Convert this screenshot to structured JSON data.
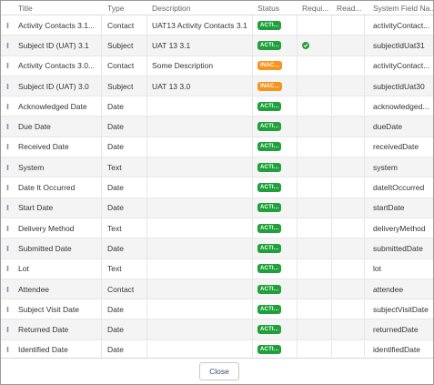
{
  "columns": {
    "title": "Title",
    "type": "Type",
    "description": "Description",
    "status": "Status",
    "required": "Requi...",
    "read_only": "Read...",
    "system_field_name": "System Field Na..."
  },
  "rows": [
    {
      "title": "Activity Contacts 3.1...",
      "type": "Contact",
      "description": "UAT13 Activity Contacts 3.1",
      "status": "ACTI...",
      "status_kind": "active",
      "required": false,
      "system_field_name": "activityContact..."
    },
    {
      "title": "Subject ID (UAT) 3.1",
      "type": "Subject",
      "description": "UAT 13 3.1",
      "status": "ACTI...",
      "status_kind": "active",
      "required": true,
      "system_field_name": "subjectIdUat31"
    },
    {
      "title": "Activity Contacts 3.0...",
      "type": "Contact",
      "description": "Some Description",
      "status": "INAC...",
      "status_kind": "inactive",
      "required": false,
      "system_field_name": "activityContact..."
    },
    {
      "title": "Subject ID (UAT) 3.0",
      "type": "Subject",
      "description": "UAT 13 3.0",
      "status": "INAC...",
      "status_kind": "inactive",
      "required": false,
      "system_field_name": "subjectIdUat30"
    },
    {
      "title": "Acknowledged Date",
      "type": "Date",
      "description": "",
      "status": "ACTI...",
      "status_kind": "active",
      "required": false,
      "system_field_name": "acknowledged..."
    },
    {
      "title": "Due Date",
      "type": "Date",
      "description": "",
      "status": "ACTI...",
      "status_kind": "active",
      "required": false,
      "system_field_name": "dueDate"
    },
    {
      "title": "Received Date",
      "type": "Date",
      "description": "",
      "status": "ACTI...",
      "status_kind": "active",
      "required": false,
      "system_field_name": "receivedDate"
    },
    {
      "title": "System",
      "type": "Text",
      "description": "",
      "status": "ACTI...",
      "status_kind": "active",
      "required": false,
      "system_field_name": "system"
    },
    {
      "title": "Date It Occurred",
      "type": "Date",
      "description": "",
      "status": "ACTI...",
      "status_kind": "active",
      "required": false,
      "system_field_name": "dateItOccurred"
    },
    {
      "title": "Start Date",
      "type": "Date",
      "description": "",
      "status": "ACTI...",
      "status_kind": "active",
      "required": false,
      "system_field_name": "startDate"
    },
    {
      "title": "Delivery Method",
      "type": "Text",
      "description": "",
      "status": "ACTI...",
      "status_kind": "active",
      "required": false,
      "system_field_name": "deliveryMethod"
    },
    {
      "title": "Submitted Date",
      "type": "Date",
      "description": "",
      "status": "ACTI...",
      "status_kind": "active",
      "required": false,
      "system_field_name": "submittedDate"
    },
    {
      "title": "Lot",
      "type": "Text",
      "description": "",
      "status": "ACTI...",
      "status_kind": "active",
      "required": false,
      "system_field_name": "lot"
    },
    {
      "title": "Attendee",
      "type": "Contact",
      "description": "",
      "status": "ACTI...",
      "status_kind": "active",
      "required": false,
      "system_field_name": "attendee"
    },
    {
      "title": "Subject Visit Date",
      "type": "Date",
      "description": "",
      "status": "ACTI...",
      "status_kind": "active",
      "required": false,
      "system_field_name": "subjectVisitDate"
    },
    {
      "title": "Returned Date",
      "type": "Date",
      "description": "",
      "status": "ACTI...",
      "status_kind": "active",
      "required": false,
      "system_field_name": "returnedDate"
    },
    {
      "title": "Identified Date",
      "type": "Date",
      "description": "",
      "status": "ACTI...",
      "status_kind": "active",
      "required": false,
      "system_field_name": "identifiedDate"
    }
  ],
  "footer": {
    "close_label": "Close"
  },
  "colors": {
    "active": "#1ea03a",
    "inactive": "#f7941d",
    "check": "#2a9d3a"
  }
}
